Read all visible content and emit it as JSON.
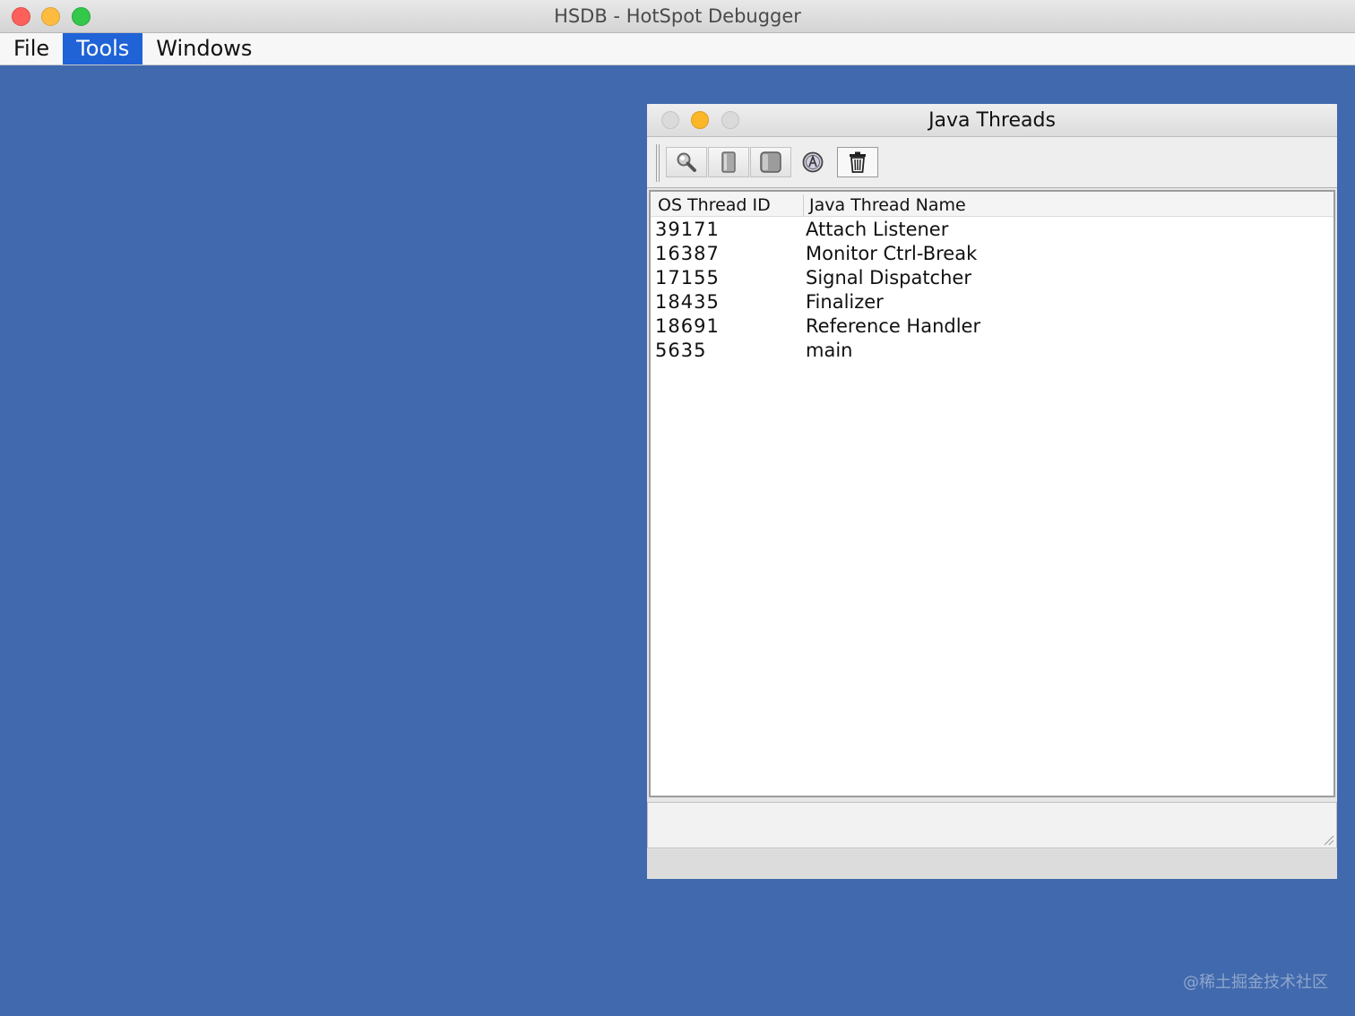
{
  "window": {
    "title": "HSDB - HotSpot Debugger"
  },
  "menu": {
    "items": [
      {
        "label": "File",
        "active": false
      },
      {
        "label": "Tools",
        "active": true
      },
      {
        "label": "Windows",
        "active": false
      }
    ]
  },
  "watermark": "@稀土掘金技术社区",
  "threads_window": {
    "title": "Java Threads",
    "toolbar": [
      {
        "icon": "magnifier-icon"
      },
      {
        "icon": "stack-icon"
      },
      {
        "icon": "memory-icon"
      },
      {
        "icon": "info-icon"
      },
      {
        "icon": "trash-icon"
      }
    ],
    "table": {
      "columns": [
        "OS Thread ID",
        "Java Thread Name"
      ],
      "rows": [
        {
          "id": "39171",
          "name": "Attach Listener"
        },
        {
          "id": "16387",
          "name": "Monitor Ctrl-Break"
        },
        {
          "id": "17155",
          "name": "Signal Dispatcher"
        },
        {
          "id": "18435",
          "name": "Finalizer"
        },
        {
          "id": "18691",
          "name": "Reference Handler"
        },
        {
          "id": "5635",
          "name": "main"
        }
      ]
    }
  },
  "colors": {
    "desktop": "#4169ad",
    "menu_active": "#1f63d6"
  }
}
